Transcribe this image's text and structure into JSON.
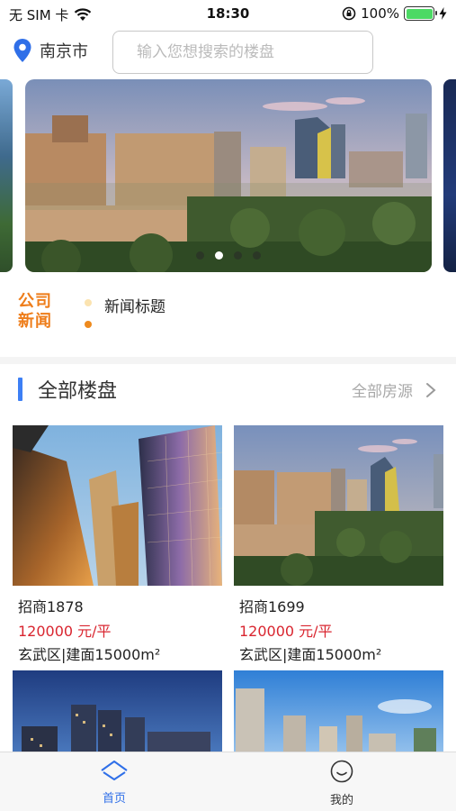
{
  "status_bar": {
    "carrier": "无 SIM 卡",
    "time": "18:30",
    "battery": "100%",
    "battery_level": 1.0
  },
  "header": {
    "city": "南京市",
    "search_placeholder": "输入您想搜索的楼盘",
    "location_icon": "location-pin-icon"
  },
  "banner": {
    "dot_count": 4,
    "active_dot": 1
  },
  "news": {
    "logo_line1": "公司",
    "logo_line2": "新闻",
    "title": "新闻标题"
  },
  "section": {
    "title": "全部楼盘",
    "more_label": "全部房源",
    "more_icon": "chevron-right-icon"
  },
  "listings": [
    {
      "name": "招商1878",
      "price": "120000 元/平",
      "info": "玄武区|建面15000m²"
    },
    {
      "name": "招商1699",
      "price": "120000 元/平",
      "info": "玄武区|建面15000m²"
    }
  ],
  "tabbar": {
    "tabs": [
      {
        "label": "首页",
        "icon": "home-icon"
      },
      {
        "label": "我的",
        "icon": "profile-smile-icon"
      }
    ]
  },
  "colors": {
    "accent_blue": "#3d7ff5",
    "price_red": "#d9252f",
    "news_orange": "#ee7d1a",
    "battery_green": "#4cd964"
  }
}
